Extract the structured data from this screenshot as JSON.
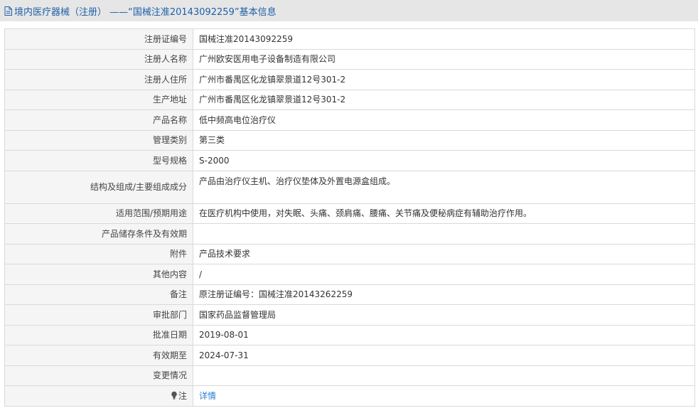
{
  "header": {
    "title": "境内医疗器械（注册） ——“国械注准20143092259”基本信息"
  },
  "rows": [
    {
      "label": "注册证编号",
      "value": "国械注准20143092259"
    },
    {
      "label": "注册人名称",
      "value": "广州欧安医用电子设备制造有限公司"
    },
    {
      "label": "注册人住所",
      "value": "广州市番禺区化龙镇翠景道12号301-2"
    },
    {
      "label": "生产地址",
      "value": "广州市番禺区化龙镇翠景道12号301-2"
    },
    {
      "label": "产品名称",
      "value": "低中频高电位治疗仪"
    },
    {
      "label": "管理类别",
      "value": "第三类"
    },
    {
      "label": "型号规格",
      "value": "S-2000"
    },
    {
      "label": "结构及组成/主要组成成分",
      "value": "产品由治疗仪主机、治疗仪垫体及外置电源盒组成。"
    },
    {
      "label": "适用范围/预期用途",
      "value": "在医疗机构中使用，对失眠、头痛、颈肩痛、腰痛、关节痛及便秘病症有辅助治疗作用。"
    },
    {
      "label": "产品储存条件及有效期",
      "value": ""
    },
    {
      "label": "附件",
      "value": "产品技术要求"
    },
    {
      "label": "其他内容",
      "value": "/"
    },
    {
      "label": "备注",
      "value": "原注册证编号：国械注准20143262259"
    },
    {
      "label": "审批部门",
      "value": "国家药品监督管理局"
    },
    {
      "label": "批准日期",
      "value": "2019-08-01"
    },
    {
      "label": "有效期至",
      "value": "2024-07-31"
    },
    {
      "label": "变更情况",
      "value": ""
    },
    {
      "label": "注",
      "value": "详情"
    }
  ],
  "icons": {
    "header_icon": "document-icon",
    "note_icon": "lightbulb-icon"
  },
  "colors": {
    "header_text": "#1f5fa8",
    "link": "#2a7fd0"
  }
}
